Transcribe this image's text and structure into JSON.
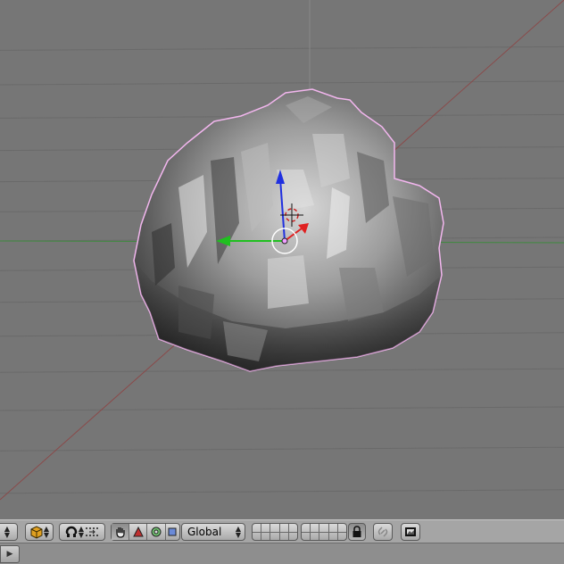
{
  "viewport": {
    "background": "#767676",
    "grid_color": "#6a6a6a",
    "x_axis_color": "#8a4a4a",
    "y_axis_color": "#3e8a3e",
    "object": {
      "type": "rock-mesh",
      "selected": true,
      "outline_color": "#f2b6ee"
    },
    "manipulator": {
      "x_color": "#e02020",
      "y_color": "#20c020",
      "z_color": "#2030e0"
    }
  },
  "header": {
    "draw_type_icon": "cube-icon",
    "proxy_icon": "magnet-icon",
    "pivot_icon": "pivot-dots-icon",
    "manipulator_modes": [
      "hand-icon",
      "translate-icon",
      "rotate-icon",
      "scale-icon"
    ],
    "orientation_label": "Global",
    "layers_row1": 10,
    "layers_row2": 10,
    "lock_icon": "lock-icon",
    "link_icon": "link-icon",
    "render_icon": "render-image-icon"
  },
  "footer": {
    "tab_icon": "play-arrow-icon"
  }
}
